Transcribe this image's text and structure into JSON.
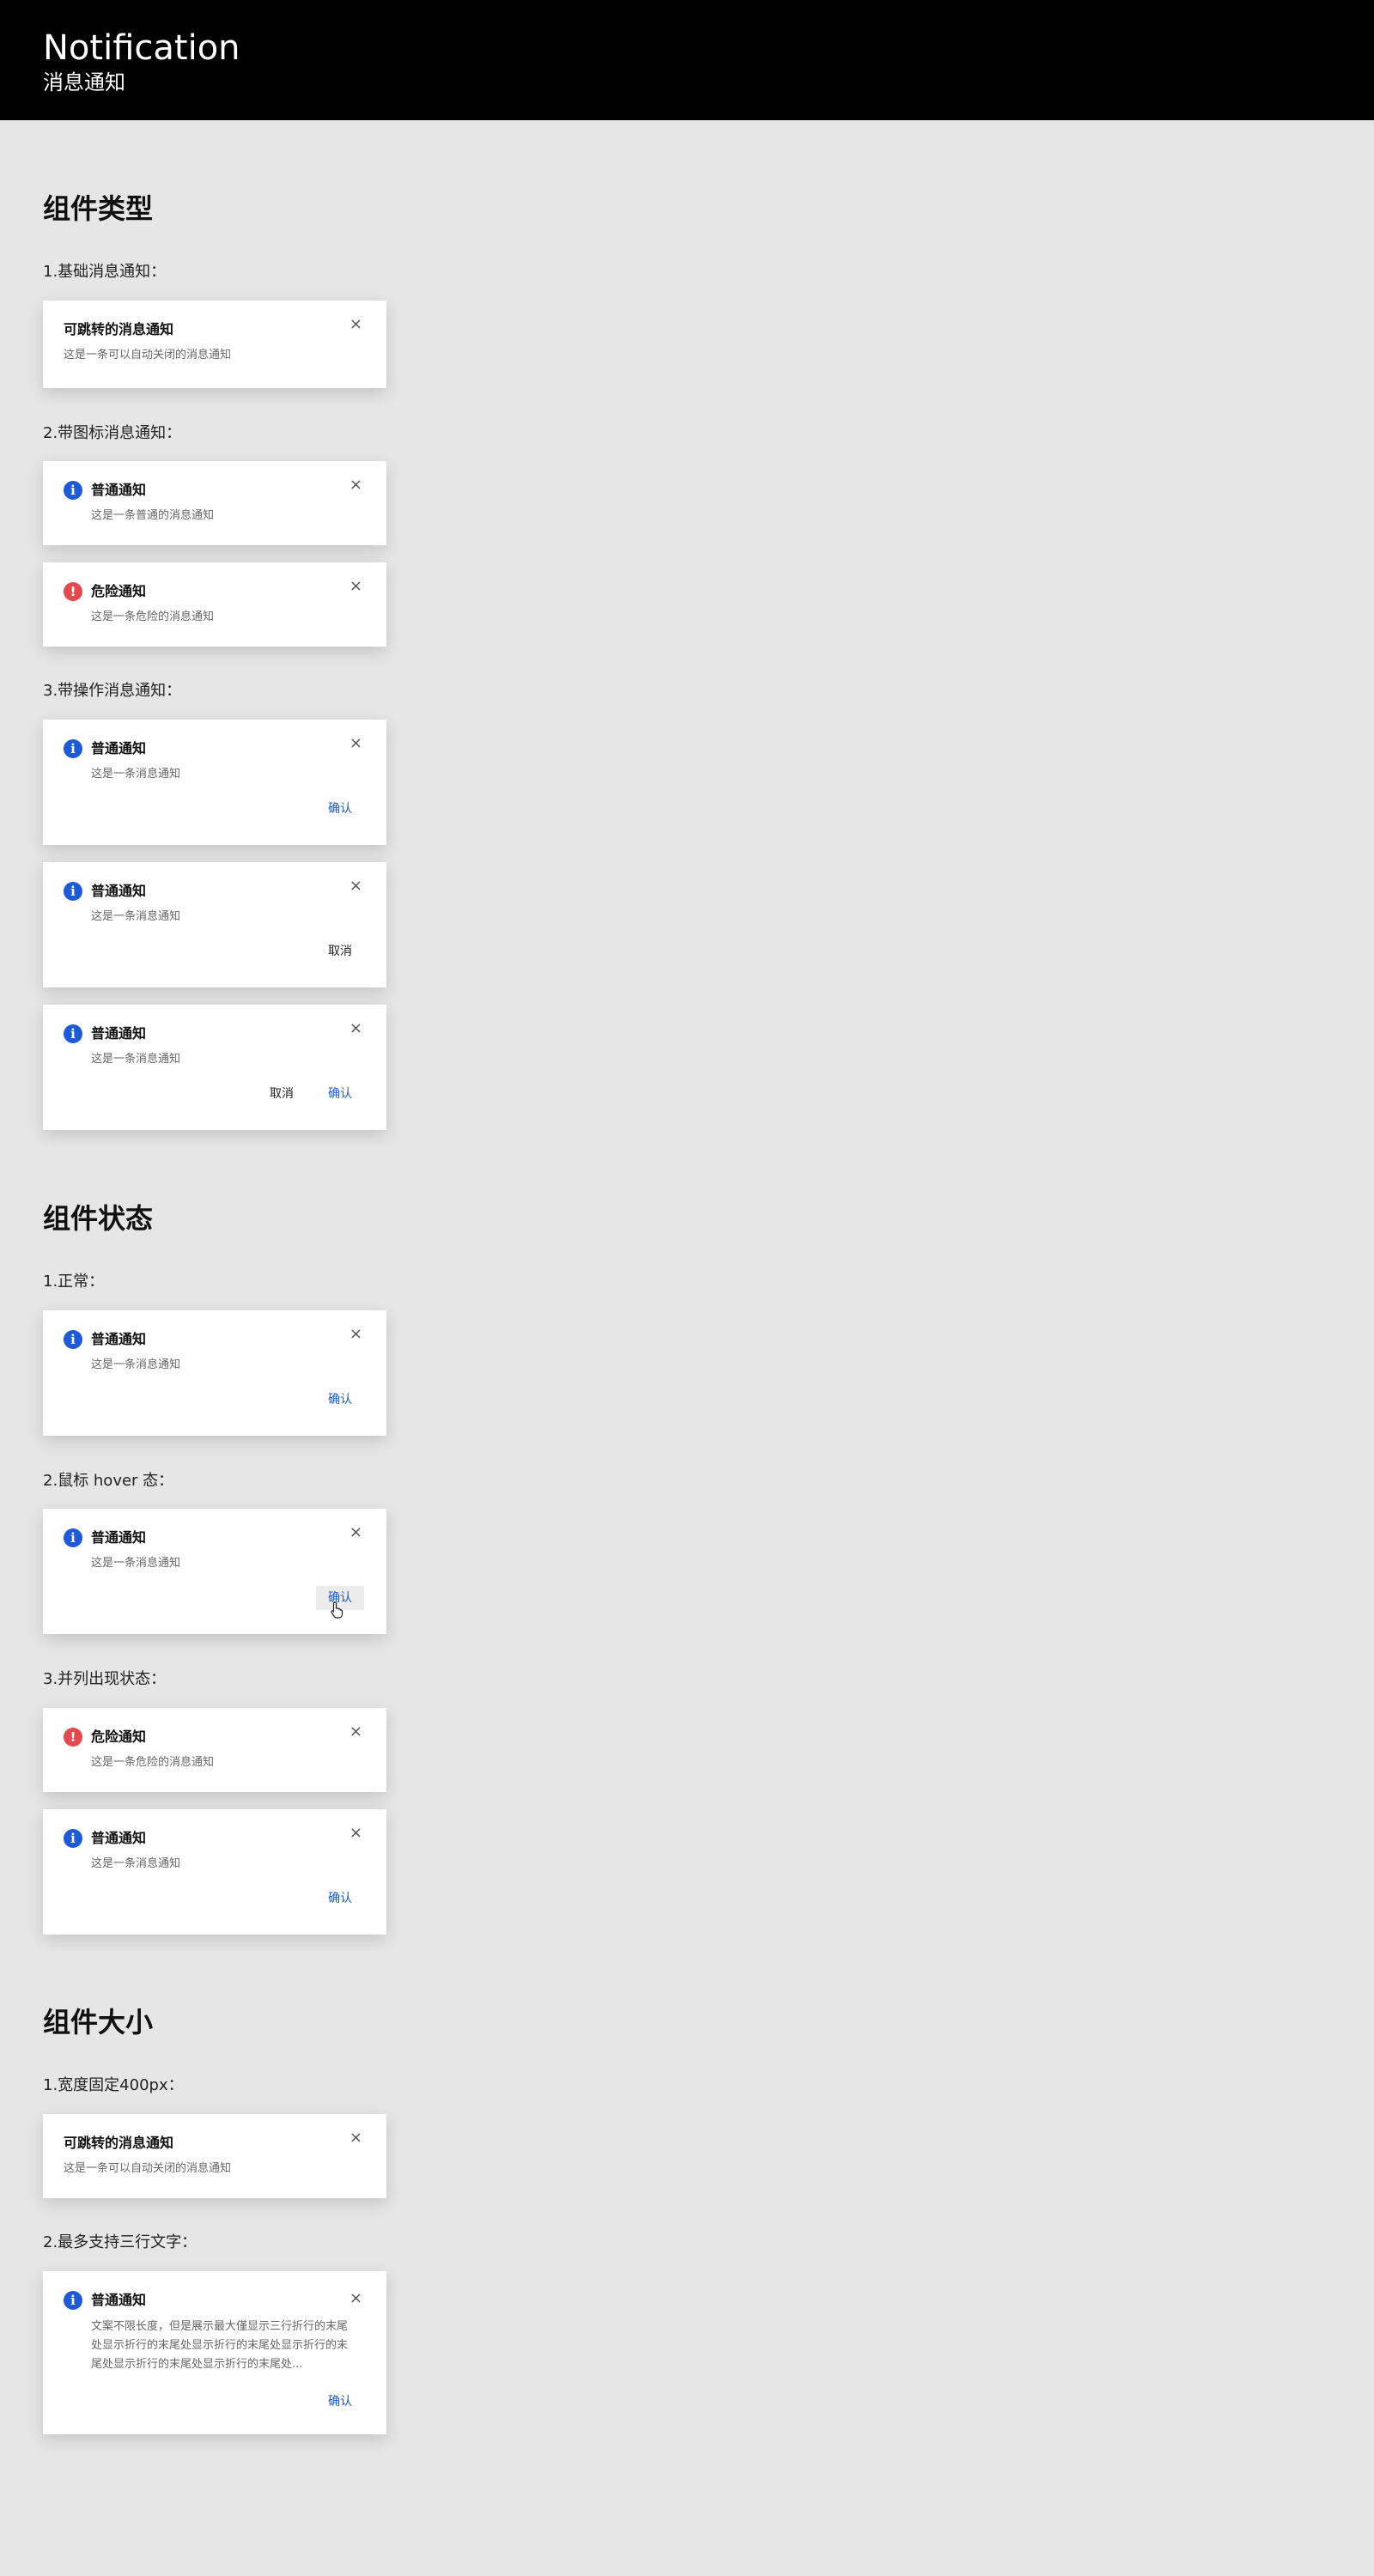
{
  "header": {
    "title": "Notification",
    "subtitle": "消息通知"
  },
  "sections": {
    "types": {
      "title": "组件类型",
      "labels": {
        "basic": "1.基础消息通知：",
        "with_icon": "2.带图标消息通知：",
        "with_action": "3.带操作消息通知："
      }
    },
    "states": {
      "title": "组件状态",
      "labels": {
        "normal": "1.正常：",
        "hover": "2.鼠标 hover 态：",
        "stacked": "3.并列出现状态："
      }
    },
    "sizes": {
      "title": "组件大小",
      "labels": {
        "fixed_width": "1.宽度固定400px：",
        "max_lines": "2.最多支持三行文字："
      }
    }
  },
  "texts": {
    "close_symbol": "×",
    "info_icon_symbol": "i",
    "danger_icon_symbol": "!",
    "link_title": "可跳转的消息通知",
    "auto_close_desc": "这是一条可以自动关闭的消息通知",
    "normal_title": "普通通知",
    "normal_desc_long": "这是一条普通的消息通知",
    "danger_title": "危险通知",
    "danger_desc": "这是一条危险的消息通知",
    "short_desc": "这是一条消息通知",
    "confirm": "确认",
    "cancel": "取消",
    "long_desc": "文案不限长度，但是展示最大僅显示三行折行的末尾处显示折行的末尾处显示折行的末尾处显示折行的末尾处显示折行的末尾处显示折行的末尾处..."
  },
  "colors": {
    "accent": "#1c5ad9",
    "danger": "#e5484d",
    "header_bg": "#000000",
    "page_bg": "#e6e6e6"
  },
  "icons": {
    "info": "info-circle-icon",
    "danger": "exclamation-circle-icon",
    "close": "close-icon",
    "cursor": "hand-pointer-icon"
  }
}
